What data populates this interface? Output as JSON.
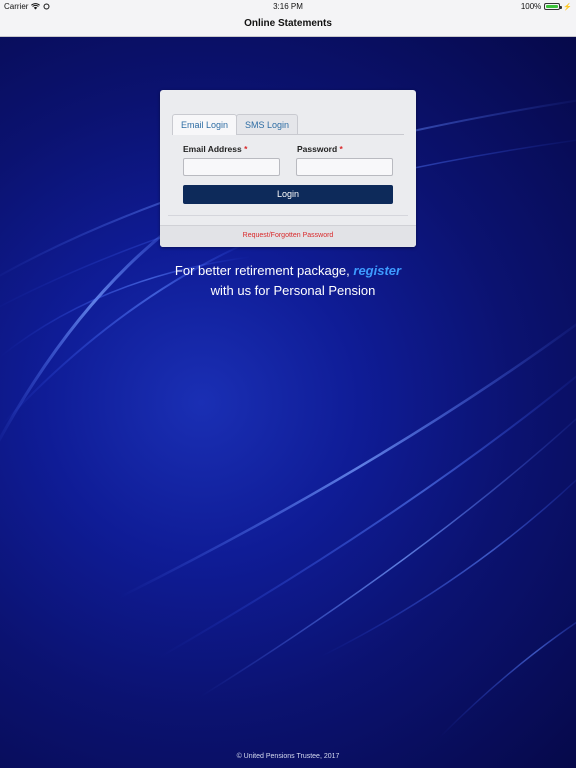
{
  "status_bar": {
    "carrier": "Carrier",
    "time": "3:16 PM",
    "battery": "100%"
  },
  "nav": {
    "title": "Online Statements"
  },
  "login": {
    "tabs": [
      "Email Login",
      "SMS Login"
    ],
    "active_tab": "Email Login",
    "email_label": "Email Address",
    "password_label": "Password",
    "required_marker": "*",
    "email_value": "",
    "password_value": "",
    "login_button": "Login",
    "forgot_link": "Request/Forgotten Password"
  },
  "promo": {
    "text_before": "For better retirement package,",
    "register_link": "register",
    "text_after": "with us for Personal Pension"
  },
  "footer": {
    "copyright": "© United Pensions Trustee, 2017"
  },
  "colors": {
    "accent_dark": "#0d2a5a",
    "link_blue": "#3d9bff",
    "required_red": "#d9292b",
    "background": "#0b1270"
  }
}
